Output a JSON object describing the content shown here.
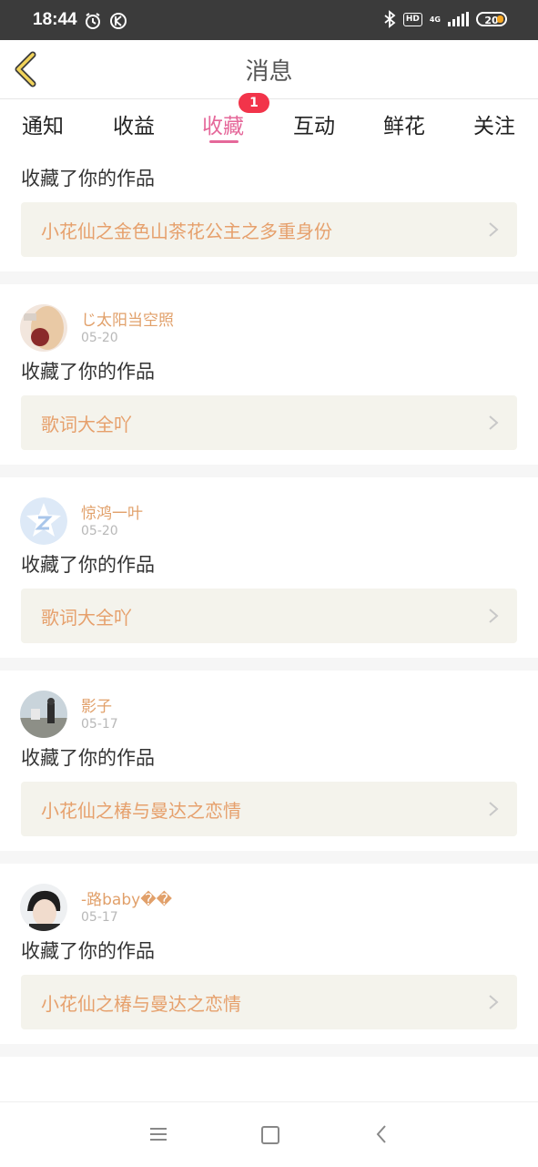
{
  "status": {
    "time": "18:44",
    "battery": "20",
    "network": "4G"
  },
  "header": {
    "title": "消息"
  },
  "tabs": [
    {
      "label": "通知"
    },
    {
      "label": "收益"
    },
    {
      "label": "收藏"
    },
    {
      "label": "互动"
    },
    {
      "label": "鲜花"
    },
    {
      "label": "关注"
    }
  ],
  "active_tab": "收藏",
  "badge_count": "1",
  "items": [
    {
      "user": "",
      "date": "",
      "action": "收藏了你的作品",
      "work": "小花仙之金色山茶花公主之多重身份"
    },
    {
      "user": "じ太阳当空照",
      "date": "05-20",
      "action": "收藏了你的作品",
      "work": "歌词大全吖"
    },
    {
      "user": "惊鸿一叶",
      "date": "05-20",
      "action": "收藏了你的作品",
      "work": "歌词大全吖"
    },
    {
      "user": "影子",
      "date": "05-17",
      "action": "收藏了你的作品",
      "work": "小花仙之椿与曼达之恋情"
    },
    {
      "user": "-路baby��",
      "date": "05-17",
      "action": "收藏了你的作品",
      "work": "小花仙之椿与曼达之恋情"
    }
  ],
  "colors": {
    "accent": "#e5689a",
    "username": "#e1a06a",
    "work_title": "#e6a06c",
    "badge": "#f2344a"
  }
}
